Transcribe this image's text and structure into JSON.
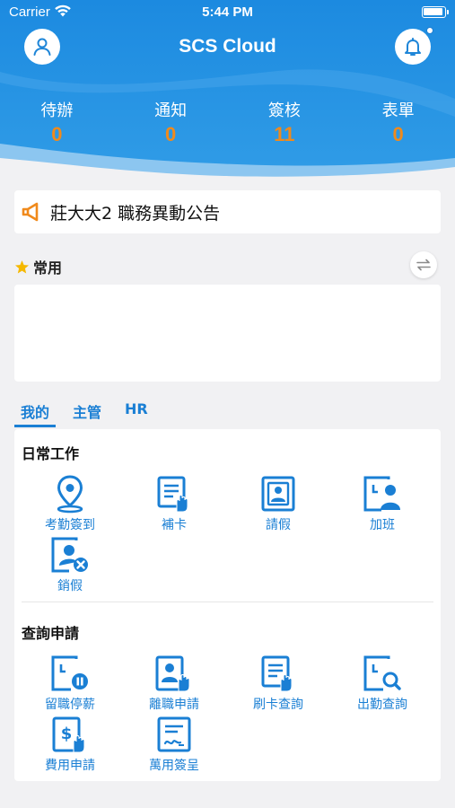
{
  "status_bar": {
    "carrier": "Carrier",
    "time": "5:44 PM"
  },
  "header": {
    "title": "SCS Cloud"
  },
  "stats": [
    {
      "label": "待辦",
      "value": "0"
    },
    {
      "label": "通知",
      "value": "0"
    },
    {
      "label": "簽核",
      "value": "11"
    },
    {
      "label": "表單",
      "value": "0"
    }
  ],
  "announcement": {
    "text": "莊大大2 職務異動公告"
  },
  "favorites": {
    "title": "常用"
  },
  "tabs": [
    {
      "label": "我的",
      "active": true
    },
    {
      "label": "主管",
      "active": false
    },
    {
      "label": "HR",
      "active": false
    }
  ],
  "sections": [
    {
      "title": "日常工作",
      "items": [
        {
          "label": "考勤簽到",
          "icon": "location-pin-icon"
        },
        {
          "label": "補卡",
          "icon": "card-punch-icon"
        },
        {
          "label": "請假",
          "icon": "leave-request-icon"
        },
        {
          "label": "加班",
          "icon": "overtime-icon"
        },
        {
          "label": "銷假",
          "icon": "cancel-leave-icon"
        }
      ]
    },
    {
      "title": "查詢申請",
      "items": [
        {
          "label": "留職停薪",
          "icon": "unpaid-leave-icon"
        },
        {
          "label": "離職申請",
          "icon": "resignation-icon"
        },
        {
          "label": "刷卡查詢",
          "icon": "card-swipe-query-icon"
        },
        {
          "label": "出勤查詢",
          "icon": "attendance-query-icon"
        },
        {
          "label": "費用申請",
          "icon": "expense-icon"
        },
        {
          "label": "萬用簽呈",
          "icon": "universal-form-icon"
        }
      ]
    }
  ],
  "colors": {
    "primary": "#1a7fd4",
    "header_blue": "#1f86d8",
    "stat_value": "#f08a1c",
    "announcement_icon": "#f08a1c",
    "star": "#f5b800"
  }
}
